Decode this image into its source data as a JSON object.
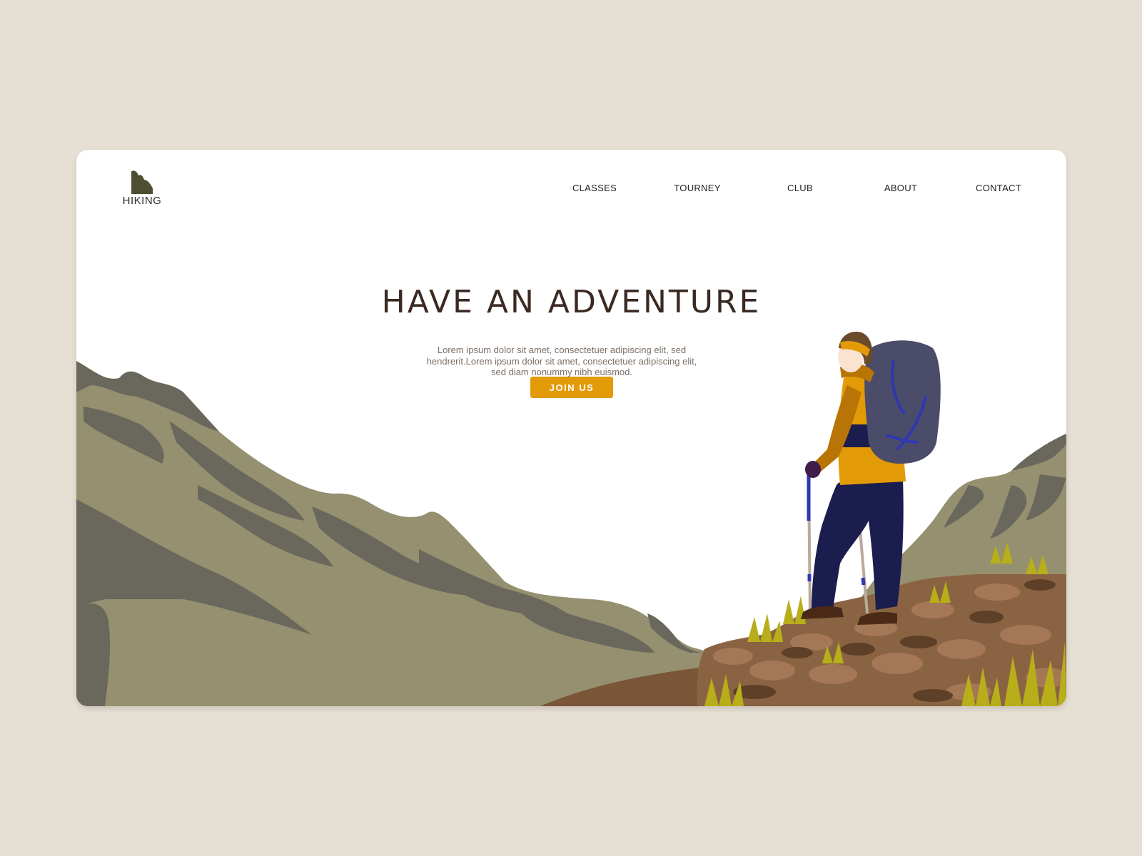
{
  "logo": {
    "text": "HIKING",
    "icon": "mountain-icon"
  },
  "nav": {
    "items": [
      {
        "label": "CLASSES"
      },
      {
        "label": "TOURNEY"
      },
      {
        "label": "CLUB"
      },
      {
        "label": "ABOUT"
      },
      {
        "label": "CONTACT"
      }
    ]
  },
  "hero": {
    "title": "HAVE AN ADVENTURE",
    "description": "Lorem ipsum dolor sit amet, consectetuer adipiscing elit, sed hendrerit.Lorem ipsum dolor sit amet, consectetuer adipiscing elit, sed diam nonummy nibh euismod.",
    "button": "JOIN US"
  },
  "colors": {
    "page_background": "#e6dfd4",
    "card_background": "#ffffff",
    "accent": "#e39a07",
    "heading": "#3a2a22",
    "logo_mark": "#4e4f32",
    "mountain": "#959070",
    "mountain_shadow": "#6a685c",
    "rock": "#8a6343",
    "grass": "#b8ae1a",
    "jacket": "#e39a07",
    "pants": "#1a1d4e",
    "backpack": "#4b4b6a"
  },
  "illustration": {
    "subject": "hiker-with-backpack-on-rocks",
    "scene": "mountain-landscape"
  }
}
